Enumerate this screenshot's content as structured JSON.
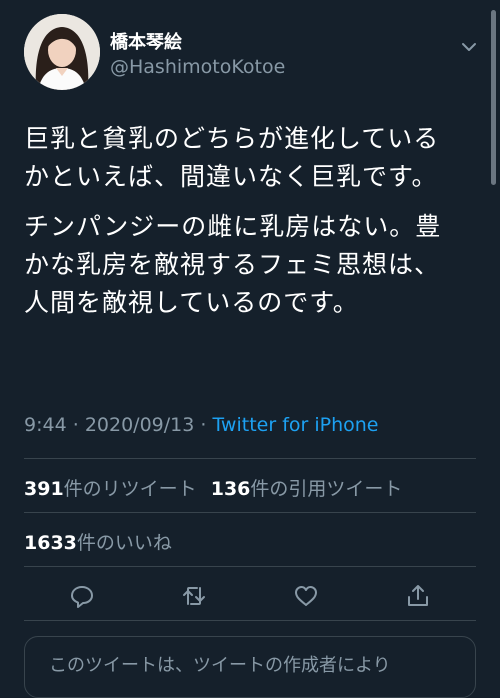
{
  "tweet": {
    "display_name": "橋本琴絵",
    "handle": "@HashimotoKotoe",
    "paragraphs": [
      "巨乳と貧乳のどちらが進化しているかといえば、間違いなく巨乳です。",
      "チンパンジーの雌に乳房はない。豊かな乳房を敵視するフェミ思想は、人間を敵視しているのです。"
    ],
    "time": "9:44",
    "date": "2020/09/13",
    "separator": "·",
    "source": "Twitter for iPhone"
  },
  "stats": {
    "retweets_count": "391",
    "retweets_label": "件のリツイート",
    "quotes_count": "136",
    "quotes_label": "件の引用ツイート",
    "likes_count": "1633",
    "likes_label": "件のいいね"
  },
  "reply_notice": "このツイートは、ツイートの作成者により",
  "icons": [
    "chevron-down-icon",
    "reply-icon",
    "retweet-icon",
    "like-icon",
    "share-icon"
  ],
  "colors": {
    "background": "#15202b",
    "text": "#ffffff",
    "muted": "#8899a6",
    "link": "#1da1f2",
    "divider": "#38444d"
  }
}
